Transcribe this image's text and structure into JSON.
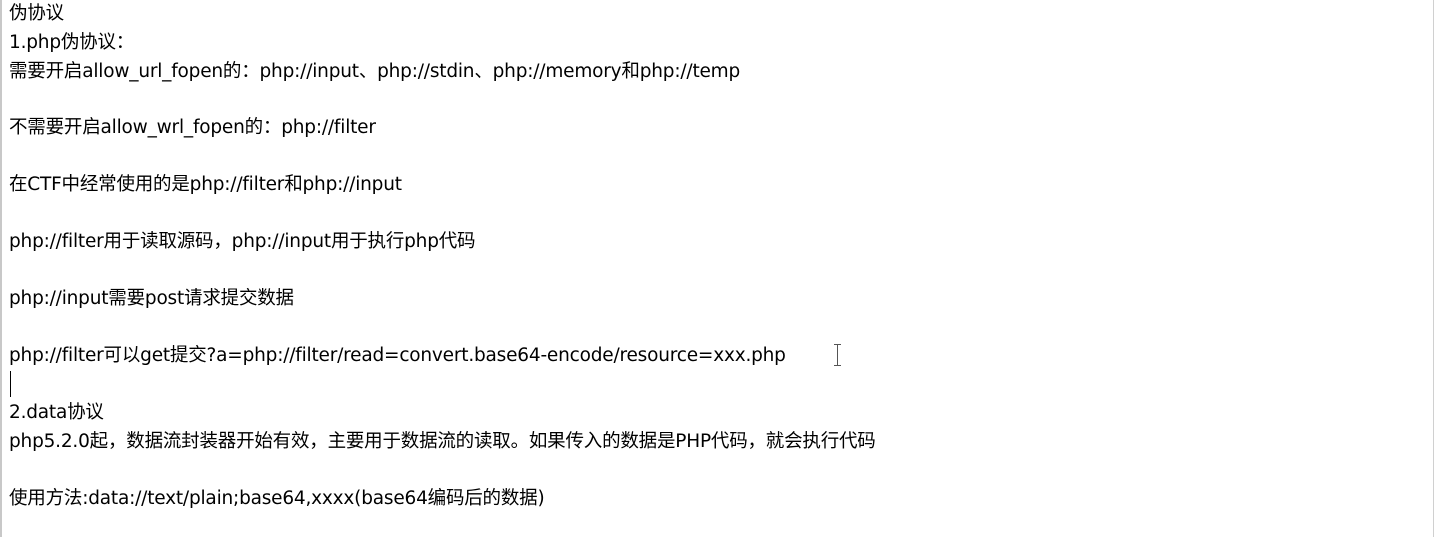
{
  "document": {
    "lines": [
      "伪协议",
      "1.php伪协议：",
      "需要开启allow_url_fopen的：php://input、php://stdin、php://memory和php://temp",
      "不需要开启allow_wrl_fopen的：php://filter",
      "在CTF中经常使用的是php://filter和php://input",
      "php://filter用于读取源码，php://input用于执行php代码",
      "php://input需要post请求提交数据",
      "php://filter可以get提交?a=php://filter/read=convert.base64-encode/resource=xxx.php",
      "2.data协议",
      "php5.2.0起，数据流封装器开始有效，主要用于数据流的读取。如果传入的数据是PHP代码，就会执行代码",
      "使用方法:data://text/plain;base64,xxxx(base64编码后的数据)"
    ]
  }
}
